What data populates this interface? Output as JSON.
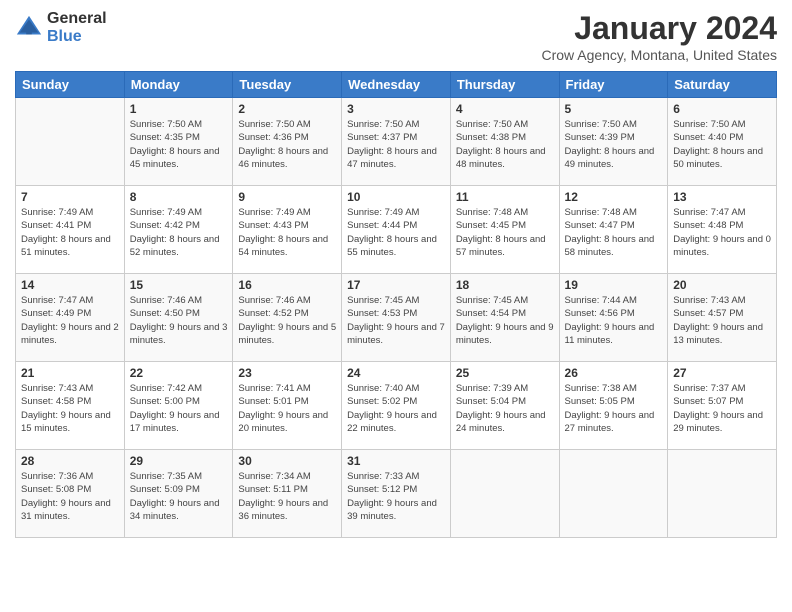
{
  "header": {
    "logo_general": "General",
    "logo_blue": "Blue",
    "title": "January 2024",
    "location": "Crow Agency, Montana, United States"
  },
  "weekdays": [
    "Sunday",
    "Monday",
    "Tuesday",
    "Wednesday",
    "Thursday",
    "Friday",
    "Saturday"
  ],
  "weeks": [
    [
      {
        "day": "",
        "sunrise": "",
        "sunset": "",
        "daylight": ""
      },
      {
        "day": "1",
        "sunrise": "Sunrise: 7:50 AM",
        "sunset": "Sunset: 4:35 PM",
        "daylight": "Daylight: 8 hours and 45 minutes."
      },
      {
        "day": "2",
        "sunrise": "Sunrise: 7:50 AM",
        "sunset": "Sunset: 4:36 PM",
        "daylight": "Daylight: 8 hours and 46 minutes."
      },
      {
        "day": "3",
        "sunrise": "Sunrise: 7:50 AM",
        "sunset": "Sunset: 4:37 PM",
        "daylight": "Daylight: 8 hours and 47 minutes."
      },
      {
        "day": "4",
        "sunrise": "Sunrise: 7:50 AM",
        "sunset": "Sunset: 4:38 PM",
        "daylight": "Daylight: 8 hours and 48 minutes."
      },
      {
        "day": "5",
        "sunrise": "Sunrise: 7:50 AM",
        "sunset": "Sunset: 4:39 PM",
        "daylight": "Daylight: 8 hours and 49 minutes."
      },
      {
        "day": "6",
        "sunrise": "Sunrise: 7:50 AM",
        "sunset": "Sunset: 4:40 PM",
        "daylight": "Daylight: 8 hours and 50 minutes."
      }
    ],
    [
      {
        "day": "7",
        "sunrise": "Sunrise: 7:49 AM",
        "sunset": "Sunset: 4:41 PM",
        "daylight": "Daylight: 8 hours and 51 minutes."
      },
      {
        "day": "8",
        "sunrise": "Sunrise: 7:49 AM",
        "sunset": "Sunset: 4:42 PM",
        "daylight": "Daylight: 8 hours and 52 minutes."
      },
      {
        "day": "9",
        "sunrise": "Sunrise: 7:49 AM",
        "sunset": "Sunset: 4:43 PM",
        "daylight": "Daylight: 8 hours and 54 minutes."
      },
      {
        "day": "10",
        "sunrise": "Sunrise: 7:49 AM",
        "sunset": "Sunset: 4:44 PM",
        "daylight": "Daylight: 8 hours and 55 minutes."
      },
      {
        "day": "11",
        "sunrise": "Sunrise: 7:48 AM",
        "sunset": "Sunset: 4:45 PM",
        "daylight": "Daylight: 8 hours and 57 minutes."
      },
      {
        "day": "12",
        "sunrise": "Sunrise: 7:48 AM",
        "sunset": "Sunset: 4:47 PM",
        "daylight": "Daylight: 8 hours and 58 minutes."
      },
      {
        "day": "13",
        "sunrise": "Sunrise: 7:47 AM",
        "sunset": "Sunset: 4:48 PM",
        "daylight": "Daylight: 9 hours and 0 minutes."
      }
    ],
    [
      {
        "day": "14",
        "sunrise": "Sunrise: 7:47 AM",
        "sunset": "Sunset: 4:49 PM",
        "daylight": "Daylight: 9 hours and 2 minutes."
      },
      {
        "day": "15",
        "sunrise": "Sunrise: 7:46 AM",
        "sunset": "Sunset: 4:50 PM",
        "daylight": "Daylight: 9 hours and 3 minutes."
      },
      {
        "day": "16",
        "sunrise": "Sunrise: 7:46 AM",
        "sunset": "Sunset: 4:52 PM",
        "daylight": "Daylight: 9 hours and 5 minutes."
      },
      {
        "day": "17",
        "sunrise": "Sunrise: 7:45 AM",
        "sunset": "Sunset: 4:53 PM",
        "daylight": "Daylight: 9 hours and 7 minutes."
      },
      {
        "day": "18",
        "sunrise": "Sunrise: 7:45 AM",
        "sunset": "Sunset: 4:54 PM",
        "daylight": "Daylight: 9 hours and 9 minutes."
      },
      {
        "day": "19",
        "sunrise": "Sunrise: 7:44 AM",
        "sunset": "Sunset: 4:56 PM",
        "daylight": "Daylight: 9 hours and 11 minutes."
      },
      {
        "day": "20",
        "sunrise": "Sunrise: 7:43 AM",
        "sunset": "Sunset: 4:57 PM",
        "daylight": "Daylight: 9 hours and 13 minutes."
      }
    ],
    [
      {
        "day": "21",
        "sunrise": "Sunrise: 7:43 AM",
        "sunset": "Sunset: 4:58 PM",
        "daylight": "Daylight: 9 hours and 15 minutes."
      },
      {
        "day": "22",
        "sunrise": "Sunrise: 7:42 AM",
        "sunset": "Sunset: 5:00 PM",
        "daylight": "Daylight: 9 hours and 17 minutes."
      },
      {
        "day": "23",
        "sunrise": "Sunrise: 7:41 AM",
        "sunset": "Sunset: 5:01 PM",
        "daylight": "Daylight: 9 hours and 20 minutes."
      },
      {
        "day": "24",
        "sunrise": "Sunrise: 7:40 AM",
        "sunset": "Sunset: 5:02 PM",
        "daylight": "Daylight: 9 hours and 22 minutes."
      },
      {
        "day": "25",
        "sunrise": "Sunrise: 7:39 AM",
        "sunset": "Sunset: 5:04 PM",
        "daylight": "Daylight: 9 hours and 24 minutes."
      },
      {
        "day": "26",
        "sunrise": "Sunrise: 7:38 AM",
        "sunset": "Sunset: 5:05 PM",
        "daylight": "Daylight: 9 hours and 27 minutes."
      },
      {
        "day": "27",
        "sunrise": "Sunrise: 7:37 AM",
        "sunset": "Sunset: 5:07 PM",
        "daylight": "Daylight: 9 hours and 29 minutes."
      }
    ],
    [
      {
        "day": "28",
        "sunrise": "Sunrise: 7:36 AM",
        "sunset": "Sunset: 5:08 PM",
        "daylight": "Daylight: 9 hours and 31 minutes."
      },
      {
        "day": "29",
        "sunrise": "Sunrise: 7:35 AM",
        "sunset": "Sunset: 5:09 PM",
        "daylight": "Daylight: 9 hours and 34 minutes."
      },
      {
        "day": "30",
        "sunrise": "Sunrise: 7:34 AM",
        "sunset": "Sunset: 5:11 PM",
        "daylight": "Daylight: 9 hours and 36 minutes."
      },
      {
        "day": "31",
        "sunrise": "Sunrise: 7:33 AM",
        "sunset": "Sunset: 5:12 PM",
        "daylight": "Daylight: 9 hours and 39 minutes."
      },
      {
        "day": "",
        "sunrise": "",
        "sunset": "",
        "daylight": ""
      },
      {
        "day": "",
        "sunrise": "",
        "sunset": "",
        "daylight": ""
      },
      {
        "day": "",
        "sunrise": "",
        "sunset": "",
        "daylight": ""
      }
    ]
  ]
}
